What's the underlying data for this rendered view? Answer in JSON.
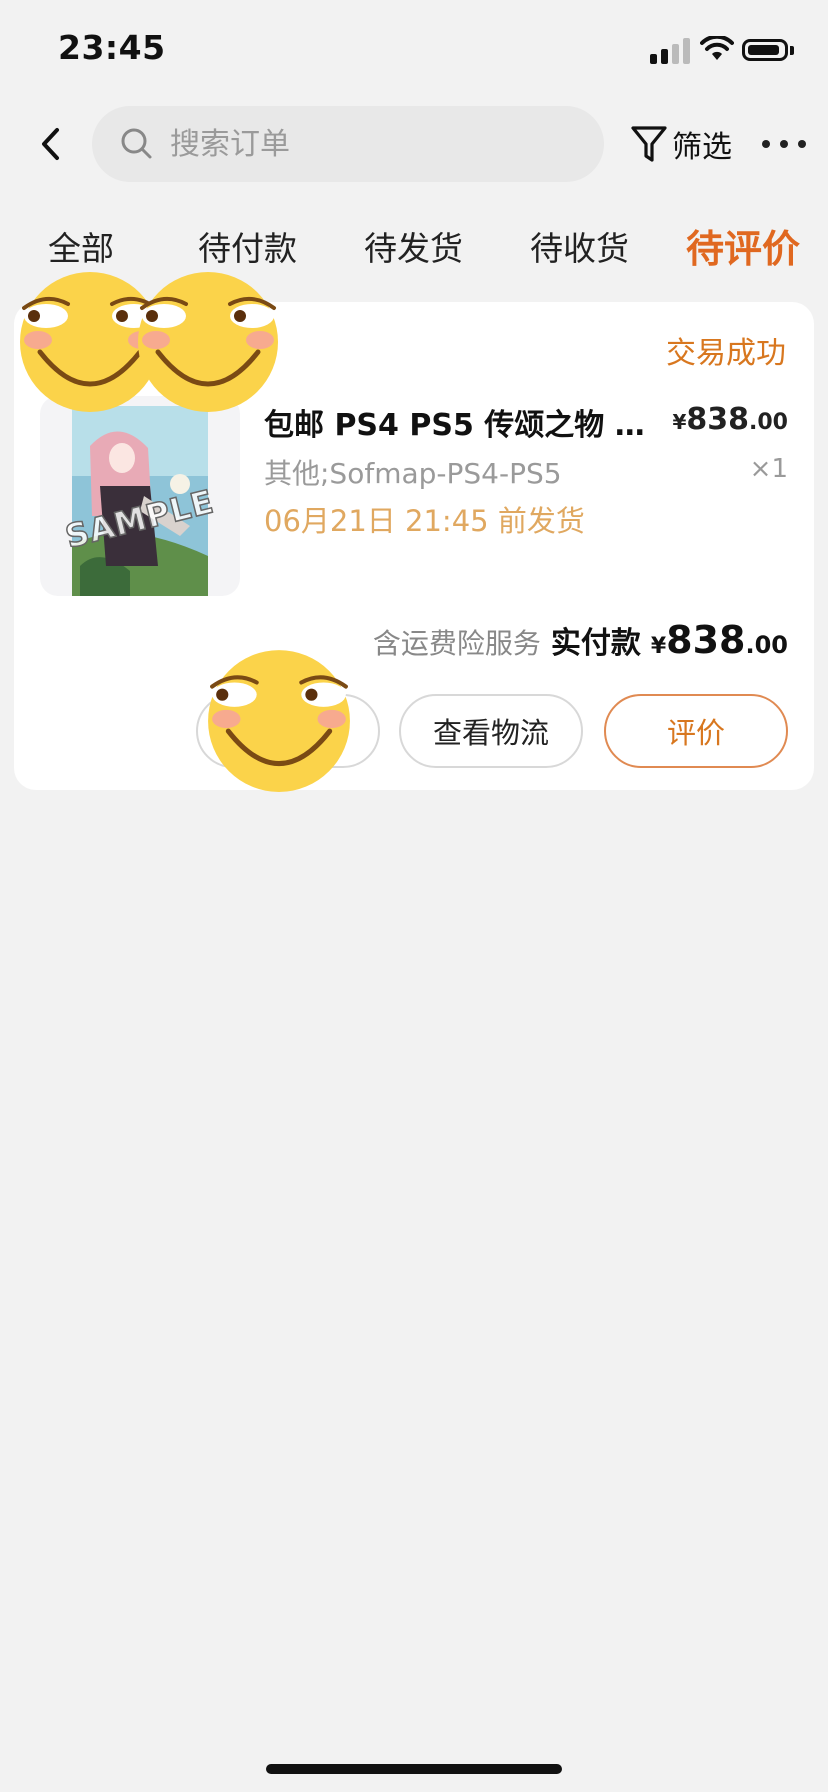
{
  "status_bar": {
    "time": "23:45"
  },
  "header": {
    "search_placeholder": "搜索订单",
    "filter_label": "筛选"
  },
  "tabs": [
    {
      "label": "全部",
      "active": false
    },
    {
      "label": "待付款",
      "active": false
    },
    {
      "label": "待发货",
      "active": false
    },
    {
      "label": "待收货",
      "active": false
    },
    {
      "label": "待评价",
      "active": true
    }
  ],
  "order": {
    "status": "交易成功",
    "product": {
      "title": "包邮 PS4 PS5 传颂之物 单…",
      "price_symbol": "¥",
      "price_int": "838",
      "price_dec": ".00",
      "sku": "其他;Sofmap-PS4-PS5",
      "quantity": "×1",
      "ship_note": "06月21日 21:45 前发货",
      "thumb_watermark": "SAMPLE"
    },
    "insurance_label": "含运费险服务",
    "paid_label": "实付款",
    "paid_symbol": "¥",
    "paid_int": "838",
    "paid_dec": ".00",
    "buttons": {
      "logistics": "查看物流",
      "review": "评价"
    }
  },
  "colors": {
    "accent": "#e06820",
    "status": "#d8771f",
    "ship_note": "#e0a860",
    "background": "#f2f2f2"
  }
}
